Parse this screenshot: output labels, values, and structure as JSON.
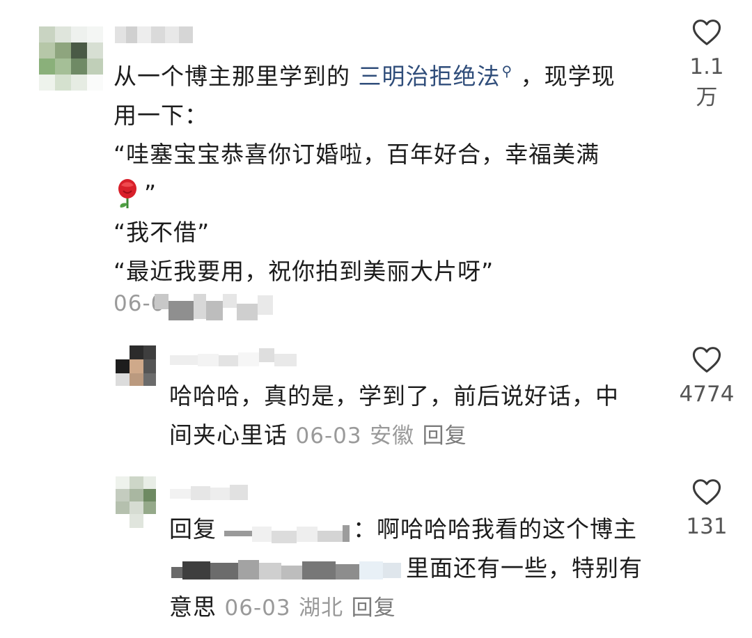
{
  "comments": [
    {
      "text_before": "从一个博主那里学到的 ",
      "link": "三明治拒绝法",
      "text_line1_end": " ，现学现",
      "text_line2": "用一下：",
      "quote1_line1": "“哇塞宝宝恭喜你订婚啦，百年好合，幸福美满",
      "quote1_line2": "”",
      "quote2": "“我不借”",
      "quote3": "“最近我要用，祝你拍到美丽大片呀”",
      "meta": "06-0",
      "likes": "1.1万"
    },
    {
      "text_line1": "哈哈哈，真的是，学到了，前后说好话，中",
      "text_line2": "间夹心里话",
      "date": "06-03",
      "location": "安徽",
      "reply": "回复",
      "likes": "4774"
    },
    {
      "prefix": "回复",
      "text_line1": "：啊哈哈哈我看的这个博主",
      "text_line2": "里面还有一些，特别有",
      "text_line3": "意思",
      "date": "06-03",
      "location": "湖北",
      "reply": "回复",
      "likes": "131"
    }
  ],
  "icons": {
    "like": "heart-outline-icon",
    "search": "search-icon",
    "rose": "rose-emoji"
  }
}
